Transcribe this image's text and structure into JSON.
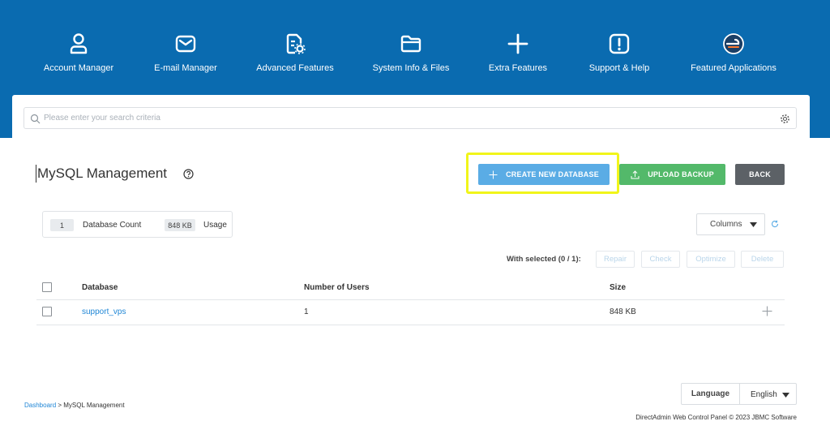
{
  "nav": {
    "items": [
      {
        "label": "Account Manager",
        "icon": "user-icon"
      },
      {
        "label": "E-mail Manager",
        "icon": "envelope-icon"
      },
      {
        "label": "Advanced Features",
        "icon": "document-gear-icon"
      },
      {
        "label": "System Info & Files",
        "icon": "folder-icon"
      },
      {
        "label": "Extra Features",
        "icon": "plus-icon"
      },
      {
        "label": "Support & Help",
        "icon": "exclamation-icon"
      },
      {
        "label": "Featured Applications",
        "icon": "app-logo-icon"
      }
    ]
  },
  "search": {
    "placeholder": "Please enter your search criteria",
    "value": ""
  },
  "page": {
    "title": "MySQL Management"
  },
  "actions": {
    "create_label": "CREATE NEW DATABASE",
    "upload_label": "UPLOAD BACKUP",
    "back_label": "BACK"
  },
  "stats": {
    "count_value": "1",
    "count_label": "Database Count",
    "usage_value": "848 KB",
    "usage_label": "Usage"
  },
  "toolbar": {
    "columns_label": "Columns",
    "with_selected": "With selected (0 / 1):",
    "bulk_actions": [
      "Repair",
      "Check",
      "Optimize",
      "Delete"
    ]
  },
  "table": {
    "headers": [
      "Database",
      "Number of Users",
      "Size"
    ],
    "rows": [
      {
        "database": "support_vps",
        "users": "1",
        "size": "848 KB"
      }
    ]
  },
  "language": {
    "label": "Language",
    "value": "English"
  },
  "breadcrumb": {
    "link": "Dashboard",
    "separator": " > ",
    "current": "MySQL Management"
  },
  "footer": {
    "text": "DirectAdmin Web Control Panel © 2023 JBMC Software"
  },
  "colors": {
    "header_bg": "#0a6bb0",
    "create_button": "#5aace5",
    "upload_button": "#53b96a",
    "back_button": "#5c6166",
    "highlight": "#f1f51a",
    "link": "#1f86d6"
  }
}
